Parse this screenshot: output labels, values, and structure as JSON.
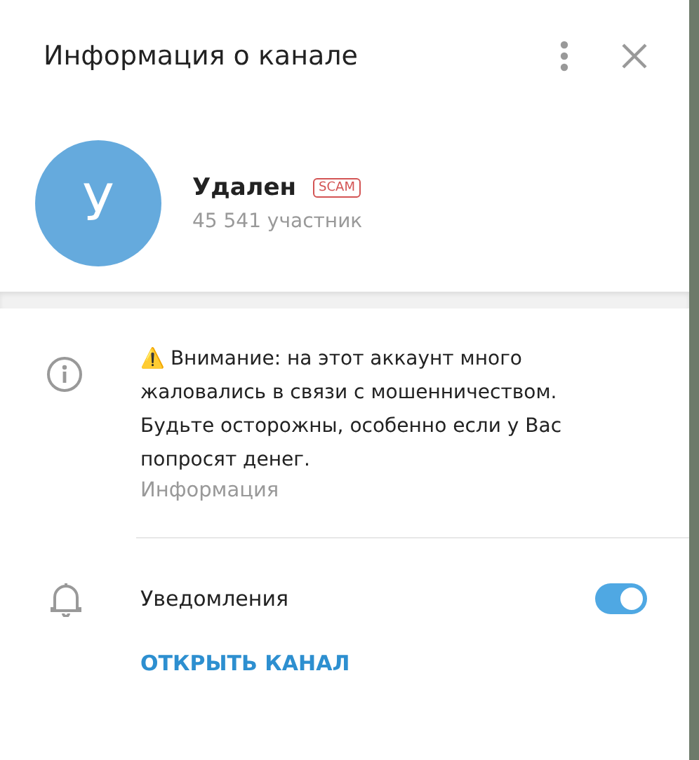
{
  "dialog": {
    "title": "Информация о канале"
  },
  "channel": {
    "avatar_letter": "У",
    "name": "Удален",
    "badge": "SCAM",
    "subtitle": "45 541 участник"
  },
  "info": {
    "text": "⚠️ Внимание: на этот аккаунт много жаловались в связи с мошенничеством. Будьте осторожны, особенно если у Вас попросят денег.",
    "caption": "Информация"
  },
  "notifications": {
    "label": "Уведомления",
    "on": true
  },
  "action": {
    "label": "ОТКРЫТЬ КАНАЛ"
  }
}
